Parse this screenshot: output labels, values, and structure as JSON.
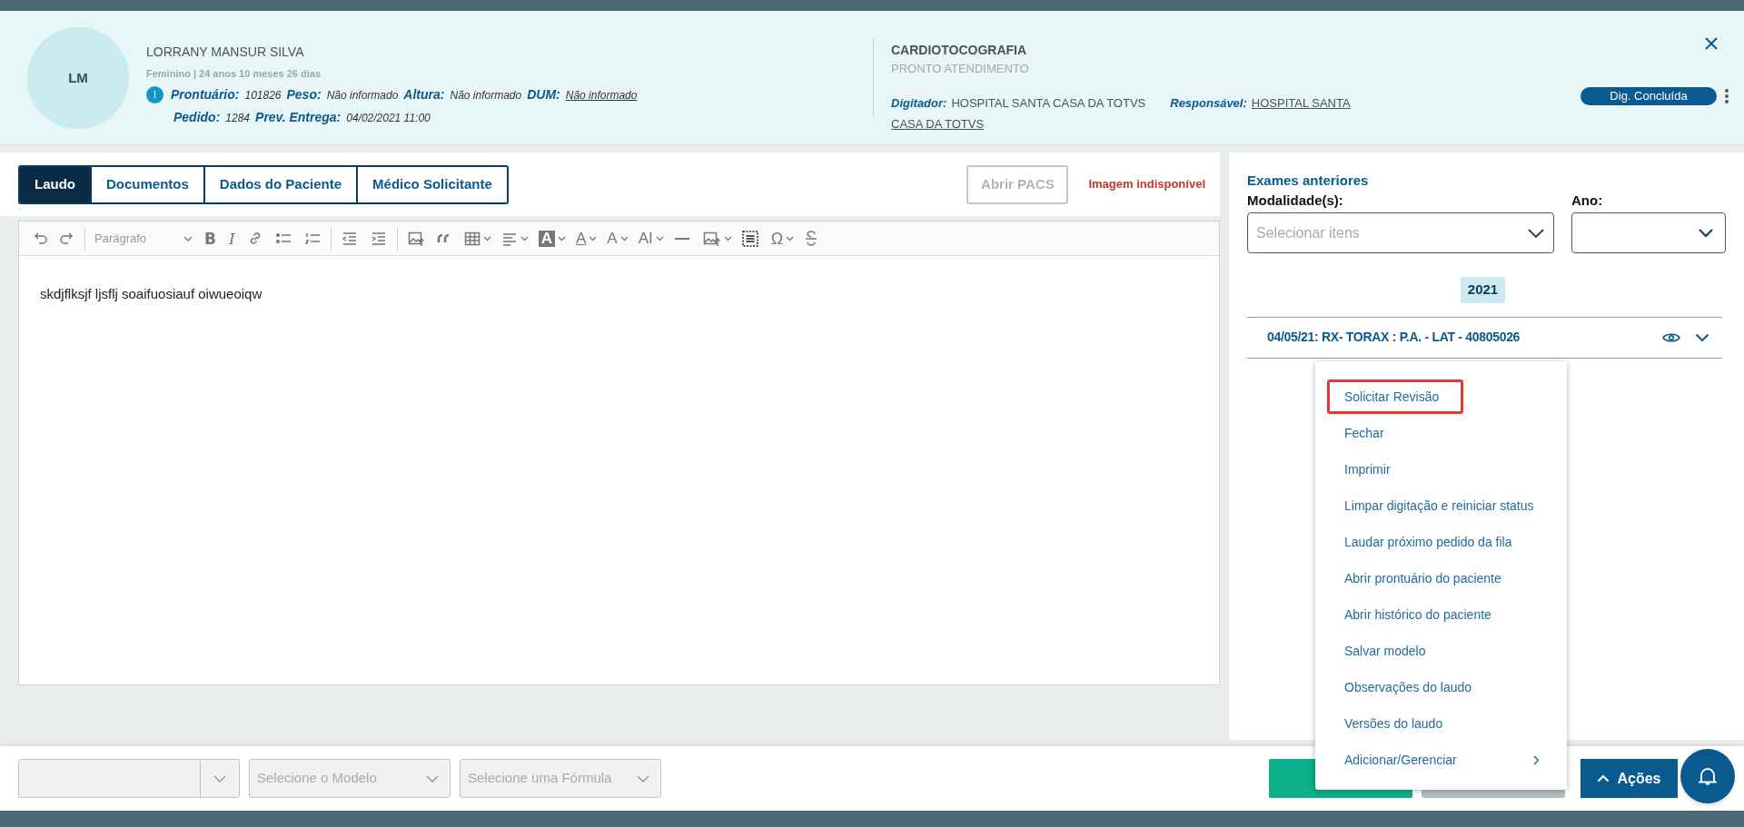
{
  "patient": {
    "initials": "LM",
    "name": "LORRANY MANSUR SILVA",
    "demographics": "Feminino | 24 anos 10 meses 26 dias",
    "info_icon": "I",
    "fields": [
      {
        "label": "Prontuário:",
        "value": "101826",
        "underlined": false
      },
      {
        "label": "Peso:",
        "value": "Não informado",
        "underlined": false
      },
      {
        "label": "Altura:",
        "value": "Não informado",
        "underlined": false
      },
      {
        "label": "DUM:",
        "value": "Não informado",
        "underlined": true
      }
    ],
    "fields_row2": [
      {
        "label": "Pedido:",
        "value": "1284",
        "underlined": false
      },
      {
        "label": "Prev. Entrega:",
        "value": "04/02/2021 11:00",
        "underlined": false
      }
    ]
  },
  "exam": {
    "title": "CARDIOTOCOGRAFIA",
    "subtitle": "PRONTO ATENDIMENTO",
    "digitador_label": "Digitador:",
    "digitador": "HOSPITAL SANTA CASA DA TOTVS",
    "responsavel_label": "Responsável:",
    "responsavel_lines": [
      "HOSPITAL SANTA",
      "CASA DA TOTVS"
    ]
  },
  "status_badge": "Dig. Concluída",
  "tabs": [
    {
      "label": "Laudo",
      "selected": true
    },
    {
      "label": "Documentos",
      "selected": false
    },
    {
      "label": "Dados do Paciente",
      "selected": false
    },
    {
      "label": "Médico Solicitante",
      "selected": false
    }
  ],
  "pacs_button": {
    "label": "Abrir PACS",
    "disabled": true
  },
  "image_status": "Imagem indisponível",
  "toolbar": {
    "block_style": "Parágrafo",
    "bold": "B",
    "italic": "I",
    "highlight": "A",
    "font_color": "A",
    "font_size": "A",
    "line_height": "AI",
    "special_characters": "Ω"
  },
  "editor_text": "skdjflksjf ljsflj soaifuosiauf oiwueoiqw",
  "previous_exams": {
    "title": "Exames anteriores",
    "modality_label": "Modalidade(s):",
    "modality_placeholder": "Selecionar itens",
    "year_label": "Ano:",
    "year_group": "2021",
    "exams": [
      {
        "text": "04/05/21: RX- TORAX : P.A. - LAT - 40805026"
      }
    ]
  },
  "menu": [
    {
      "label": "Solicitar Revisão",
      "highlighted": true,
      "submenu": false
    },
    {
      "label": "Fechar",
      "highlighted": false,
      "submenu": false
    },
    {
      "label": "Imprimir",
      "highlighted": false,
      "submenu": false
    },
    {
      "label": "Limpar digitação e reiniciar status",
      "highlighted": false,
      "submenu": false
    },
    {
      "label": "Laudar próximo pedido da fila",
      "highlighted": false,
      "submenu": false
    },
    {
      "label": "Abrir prontuário do paciente",
      "highlighted": false,
      "submenu": false
    },
    {
      "label": "Abrir histórico do paciente",
      "highlighted": false,
      "submenu": false
    },
    {
      "label": "Salvar modelo",
      "highlighted": false,
      "submenu": false
    },
    {
      "label": "Observações do laudo",
      "highlighted": false,
      "submenu": false
    },
    {
      "label": "Versões do laudo",
      "highlighted": false,
      "submenu": false
    },
    {
      "label": "Adicionar/Gerenciar",
      "highlighted": false,
      "submenu": true
    }
  ],
  "bottom_selects": [
    {
      "kind": "split"
    },
    {
      "kind": "plain",
      "placeholder": "Selecione o Modelo"
    },
    {
      "kind": "plain",
      "placeholder": "Selecione uma Fórmula"
    }
  ],
  "actions_button": "Ações"
}
